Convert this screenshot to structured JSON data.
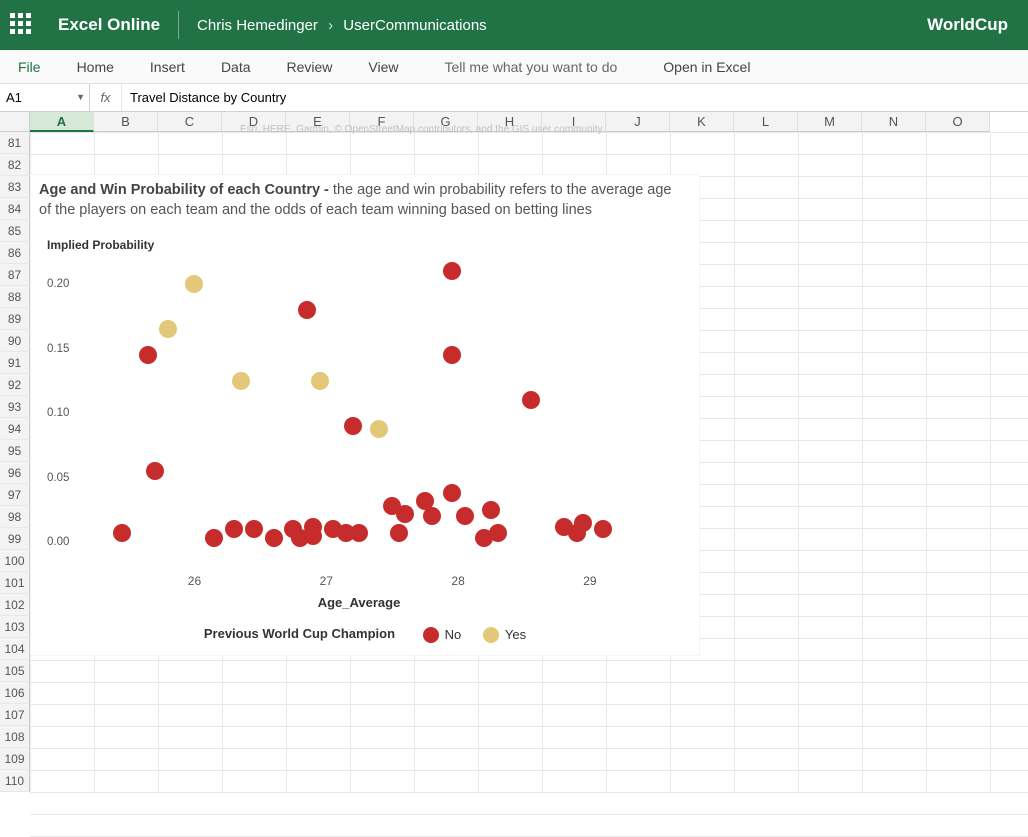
{
  "header": {
    "app_name": "Excel Online",
    "user": "Chris Hemedinger",
    "folder": "UserCommunications",
    "doc_title": "WorldCup"
  },
  "menu": {
    "file": "File",
    "home": "Home",
    "insert": "Insert",
    "data": "Data",
    "review": "Review",
    "view": "View",
    "tell_me": "Tell me what you want to do",
    "open_in_excel": "Open in Excel"
  },
  "formula_bar": {
    "cell_ref": "A1",
    "fx": "fx",
    "formula": "Travel Distance by Country"
  },
  "columns": [
    "A",
    "B",
    "C",
    "D",
    "E",
    "F",
    "G",
    "H",
    "I",
    "J",
    "K",
    "L",
    "M",
    "N",
    "O"
  ],
  "rows": [
    81,
    82,
    83,
    84,
    85,
    86,
    87,
    88,
    89,
    90,
    91,
    92,
    93,
    94,
    95,
    96,
    97,
    98,
    99,
    100,
    101,
    102,
    103,
    104,
    105,
    106,
    107,
    108,
    109,
    110
  ],
  "attribution": "Esri, HERE, Garmin, © OpenStreetMap contributors, and the GIS user community",
  "chart": {
    "title_bold": "Age and Win Probability of each Country - ",
    "title_rest": "the age and win probability refers to the average age of the players on each team and the odds of each team winning based on betting lines",
    "ylabel": "Implied Probability",
    "xlabel": "Age_Average",
    "legend_title": "Previous World Cup Champion",
    "legend_no": "No",
    "legend_yes": "Yes",
    "xticks": [
      "26",
      "27",
      "28",
      "29"
    ],
    "yticks": [
      "0.00",
      "0.05",
      "0.10",
      "0.15",
      "0.20"
    ]
  },
  "chart_data": {
    "type": "scatter",
    "title": "Age and Win Probability of each Country",
    "xlabel": "Age_Average",
    "ylabel": "Implied Probability",
    "xlim": [
      25.2,
      29.6
    ],
    "ylim": [
      -0.02,
      0.22
    ],
    "legend_title": "Previous World Cup Champion",
    "series": [
      {
        "name": "No",
        "color": "#c72c2c",
        "points": [
          {
            "x": 25.45,
            "y": 0.007
          },
          {
            "x": 25.65,
            "y": 0.145
          },
          {
            "x": 25.7,
            "y": 0.055
          },
          {
            "x": 26.15,
            "y": 0.003
          },
          {
            "x": 26.3,
            "y": 0.01
          },
          {
            "x": 26.45,
            "y": 0.01
          },
          {
            "x": 26.6,
            "y": 0.003
          },
          {
            "x": 26.75,
            "y": 0.01
          },
          {
            "x": 26.8,
            "y": 0.003
          },
          {
            "x": 26.85,
            "y": 0.18
          },
          {
            "x": 26.9,
            "y": 0.012
          },
          {
            "x": 26.9,
            "y": 0.005
          },
          {
            "x": 27.05,
            "y": 0.01
          },
          {
            "x": 27.15,
            "y": 0.007
          },
          {
            "x": 27.2,
            "y": 0.09
          },
          {
            "x": 27.25,
            "y": 0.007
          },
          {
            "x": 27.5,
            "y": 0.028
          },
          {
            "x": 27.55,
            "y": 0.007
          },
          {
            "x": 27.6,
            "y": 0.022
          },
          {
            "x": 27.75,
            "y": 0.032
          },
          {
            "x": 27.8,
            "y": 0.02
          },
          {
            "x": 27.95,
            "y": 0.145
          },
          {
            "x": 27.95,
            "y": 0.21
          },
          {
            "x": 27.95,
            "y": 0.038
          },
          {
            "x": 28.05,
            "y": 0.02
          },
          {
            "x": 28.2,
            "y": 0.003
          },
          {
            "x": 28.25,
            "y": 0.025
          },
          {
            "x": 28.3,
            "y": 0.007
          },
          {
            "x": 28.55,
            "y": 0.11
          },
          {
            "x": 28.8,
            "y": 0.012
          },
          {
            "x": 28.9,
            "y": 0.007
          },
          {
            "x": 28.95,
            "y": 0.015
          },
          {
            "x": 29.1,
            "y": 0.01
          }
        ]
      },
      {
        "name": "Yes",
        "color": "#e3c879",
        "points": [
          {
            "x": 25.8,
            "y": 0.165
          },
          {
            "x": 26.0,
            "y": 0.2
          },
          {
            "x": 26.35,
            "y": 0.125
          },
          {
            "x": 26.95,
            "y": 0.125
          },
          {
            "x": 27.4,
            "y": 0.088
          }
        ]
      }
    ]
  }
}
